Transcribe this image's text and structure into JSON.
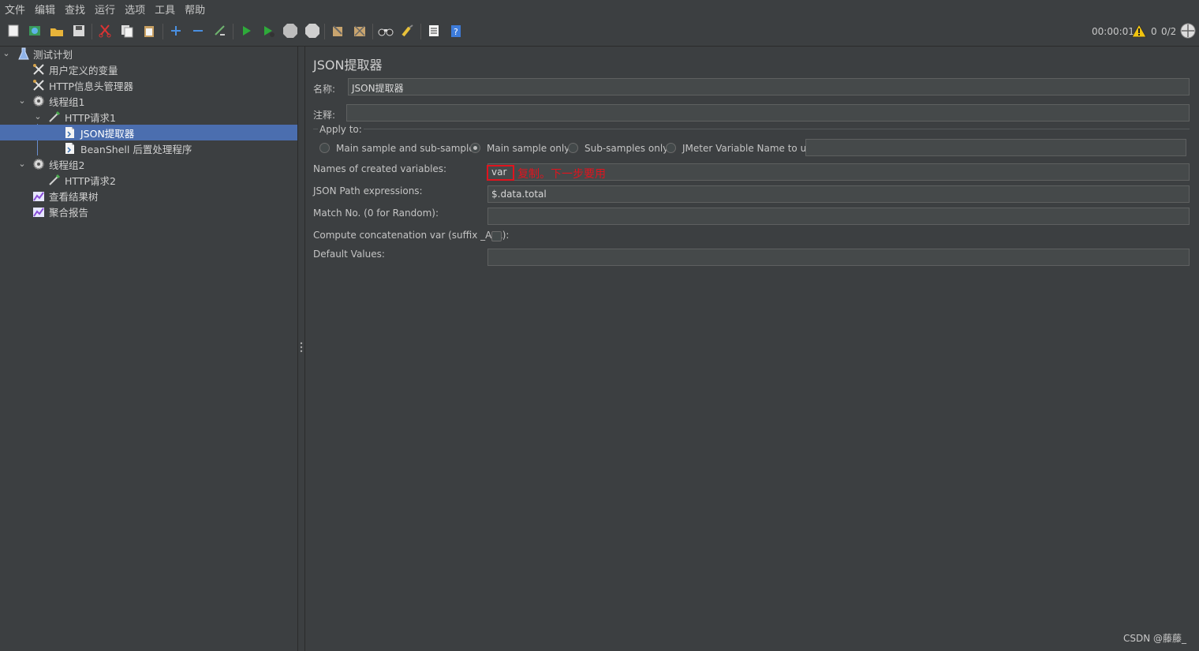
{
  "menu": [
    "文件",
    "编辑",
    "查找",
    "运行",
    "选项",
    "工具",
    "帮助"
  ],
  "toolbar": {
    "icons": [
      "new-icon",
      "templates-icon",
      "open-icon",
      "save-icon",
      "cut-icon",
      "copy-icon",
      "paste-icon",
      "expand-icon",
      "collapse-icon",
      "toggle-icon",
      "start-icon",
      "start-no-pause-icon",
      "stop-icon",
      "shutdown-icon",
      "clear-icon",
      "clear-all-icon",
      "search-icon",
      "reset-search-icon",
      "function-helper-icon",
      "help-icon"
    ],
    "timer": "00:00:01",
    "warnings": "0",
    "threads": "0/2"
  },
  "tree": {
    "items": [
      {
        "label": "测试计划",
        "icon": "test-plan-icon"
      },
      {
        "label": "用户定义的变量",
        "icon": "config-icon"
      },
      {
        "label": "HTTP信息头管理器",
        "icon": "config-icon"
      },
      {
        "label": "线程组1",
        "icon": "thread-group-icon"
      },
      {
        "label": "HTTP请求1",
        "icon": "sampler-icon"
      },
      {
        "label": "JSON提取器",
        "icon": "post-processor-icon"
      },
      {
        "label": "BeanShell 后置处理程序",
        "icon": "post-processor-icon"
      },
      {
        "label": "线程组2",
        "icon": "thread-group-icon"
      },
      {
        "label": "HTTP请求2",
        "icon": "sampler-icon"
      },
      {
        "label": "查看结果树",
        "icon": "listener-icon"
      },
      {
        "label": "聚合报告",
        "icon": "listener-icon"
      }
    ]
  },
  "panel": {
    "title": "JSON提取器",
    "name_label": "名称:",
    "name_value": "JSON提取器",
    "comment_label": "注释:",
    "comment_value": "",
    "apply_to_label": "Apply to:",
    "apply_options": [
      "Main sample and sub-samples",
      "Main sample only",
      "Sub-samples only",
      "JMeter Variable Name to use"
    ],
    "apply_selected": "Main sample only",
    "jmeter_var_value": "",
    "names_label": "Names of created variables:",
    "names_value": "var",
    "json_path_label": "JSON Path expressions:",
    "json_path_value": "$.data.total",
    "match_label": "Match No. (0 for Random):",
    "match_value": "",
    "concat_label": "Compute concatenation var (suffix _ALL):",
    "concat_checked": false,
    "default_label": "Default Values:",
    "default_value": ""
  },
  "annotation": {
    "text": "复制。下一步要用",
    "color": "#e0141e"
  },
  "watermark": "CSDN @藤藤_",
  "colors": {
    "selection": "#4b6eaf",
    "background": "#3c3f41",
    "field": "#45494a"
  }
}
